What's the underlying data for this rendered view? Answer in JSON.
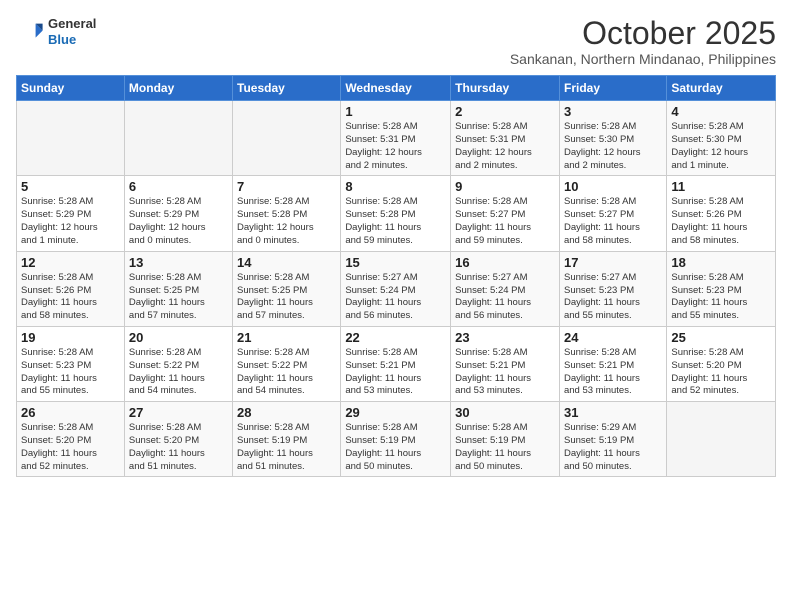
{
  "logo": {
    "general": "General",
    "blue": "Blue"
  },
  "header": {
    "month": "October 2025",
    "location": "Sankanan, Northern Mindanao, Philippines"
  },
  "weekdays": [
    "Sunday",
    "Monday",
    "Tuesday",
    "Wednesday",
    "Thursday",
    "Friday",
    "Saturday"
  ],
  "weeks": [
    [
      {
        "day": "",
        "info": ""
      },
      {
        "day": "",
        "info": ""
      },
      {
        "day": "",
        "info": ""
      },
      {
        "day": "1",
        "info": "Sunrise: 5:28 AM\nSunset: 5:31 PM\nDaylight: 12 hours\nand 2 minutes."
      },
      {
        "day": "2",
        "info": "Sunrise: 5:28 AM\nSunset: 5:31 PM\nDaylight: 12 hours\nand 2 minutes."
      },
      {
        "day": "3",
        "info": "Sunrise: 5:28 AM\nSunset: 5:30 PM\nDaylight: 12 hours\nand 2 minutes."
      },
      {
        "day": "4",
        "info": "Sunrise: 5:28 AM\nSunset: 5:30 PM\nDaylight: 12 hours\nand 1 minute."
      }
    ],
    [
      {
        "day": "5",
        "info": "Sunrise: 5:28 AM\nSunset: 5:29 PM\nDaylight: 12 hours\nand 1 minute."
      },
      {
        "day": "6",
        "info": "Sunrise: 5:28 AM\nSunset: 5:29 PM\nDaylight: 12 hours\nand 0 minutes."
      },
      {
        "day": "7",
        "info": "Sunrise: 5:28 AM\nSunset: 5:28 PM\nDaylight: 12 hours\nand 0 minutes."
      },
      {
        "day": "8",
        "info": "Sunrise: 5:28 AM\nSunset: 5:28 PM\nDaylight: 11 hours\nand 59 minutes."
      },
      {
        "day": "9",
        "info": "Sunrise: 5:28 AM\nSunset: 5:27 PM\nDaylight: 11 hours\nand 59 minutes."
      },
      {
        "day": "10",
        "info": "Sunrise: 5:28 AM\nSunset: 5:27 PM\nDaylight: 11 hours\nand 58 minutes."
      },
      {
        "day": "11",
        "info": "Sunrise: 5:28 AM\nSunset: 5:26 PM\nDaylight: 11 hours\nand 58 minutes."
      }
    ],
    [
      {
        "day": "12",
        "info": "Sunrise: 5:28 AM\nSunset: 5:26 PM\nDaylight: 11 hours\nand 58 minutes."
      },
      {
        "day": "13",
        "info": "Sunrise: 5:28 AM\nSunset: 5:25 PM\nDaylight: 11 hours\nand 57 minutes."
      },
      {
        "day": "14",
        "info": "Sunrise: 5:28 AM\nSunset: 5:25 PM\nDaylight: 11 hours\nand 57 minutes."
      },
      {
        "day": "15",
        "info": "Sunrise: 5:27 AM\nSunset: 5:24 PM\nDaylight: 11 hours\nand 56 minutes."
      },
      {
        "day": "16",
        "info": "Sunrise: 5:27 AM\nSunset: 5:24 PM\nDaylight: 11 hours\nand 56 minutes."
      },
      {
        "day": "17",
        "info": "Sunrise: 5:27 AM\nSunset: 5:23 PM\nDaylight: 11 hours\nand 55 minutes."
      },
      {
        "day": "18",
        "info": "Sunrise: 5:28 AM\nSunset: 5:23 PM\nDaylight: 11 hours\nand 55 minutes."
      }
    ],
    [
      {
        "day": "19",
        "info": "Sunrise: 5:28 AM\nSunset: 5:23 PM\nDaylight: 11 hours\nand 55 minutes."
      },
      {
        "day": "20",
        "info": "Sunrise: 5:28 AM\nSunset: 5:22 PM\nDaylight: 11 hours\nand 54 minutes."
      },
      {
        "day": "21",
        "info": "Sunrise: 5:28 AM\nSunset: 5:22 PM\nDaylight: 11 hours\nand 54 minutes."
      },
      {
        "day": "22",
        "info": "Sunrise: 5:28 AM\nSunset: 5:21 PM\nDaylight: 11 hours\nand 53 minutes."
      },
      {
        "day": "23",
        "info": "Sunrise: 5:28 AM\nSunset: 5:21 PM\nDaylight: 11 hours\nand 53 minutes."
      },
      {
        "day": "24",
        "info": "Sunrise: 5:28 AM\nSunset: 5:21 PM\nDaylight: 11 hours\nand 53 minutes."
      },
      {
        "day": "25",
        "info": "Sunrise: 5:28 AM\nSunset: 5:20 PM\nDaylight: 11 hours\nand 52 minutes."
      }
    ],
    [
      {
        "day": "26",
        "info": "Sunrise: 5:28 AM\nSunset: 5:20 PM\nDaylight: 11 hours\nand 52 minutes."
      },
      {
        "day": "27",
        "info": "Sunrise: 5:28 AM\nSunset: 5:20 PM\nDaylight: 11 hours\nand 51 minutes."
      },
      {
        "day": "28",
        "info": "Sunrise: 5:28 AM\nSunset: 5:19 PM\nDaylight: 11 hours\nand 51 minutes."
      },
      {
        "day": "29",
        "info": "Sunrise: 5:28 AM\nSunset: 5:19 PM\nDaylight: 11 hours\nand 50 minutes."
      },
      {
        "day": "30",
        "info": "Sunrise: 5:28 AM\nSunset: 5:19 PM\nDaylight: 11 hours\nand 50 minutes."
      },
      {
        "day": "31",
        "info": "Sunrise: 5:29 AM\nSunset: 5:19 PM\nDaylight: 11 hours\nand 50 minutes."
      },
      {
        "day": "",
        "info": ""
      }
    ]
  ]
}
